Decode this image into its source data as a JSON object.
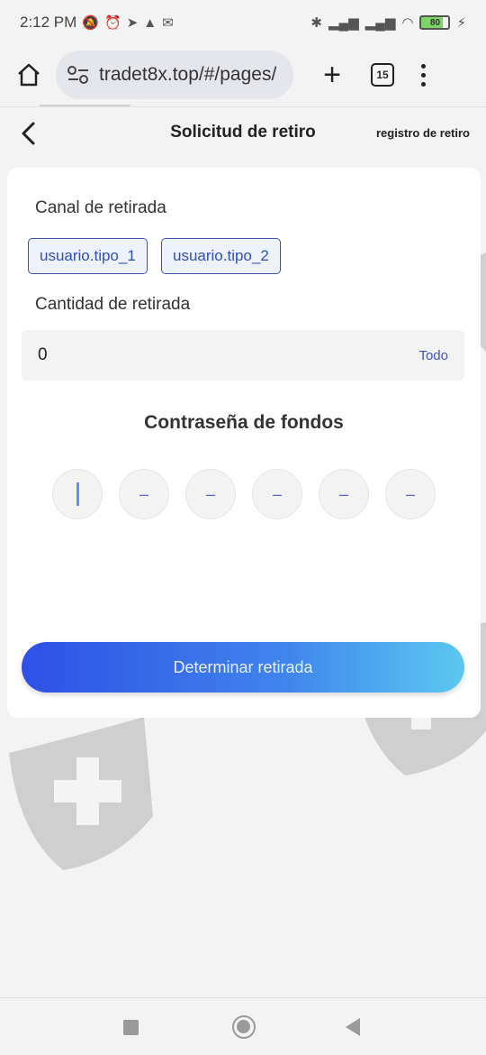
{
  "status_bar": {
    "time": "2:12 PM",
    "battery": "80",
    "icons": [
      "mute-icon",
      "alarm-icon",
      "telegram-icon",
      "app-icon",
      "notification-icon",
      "bluetooth-icon",
      "signal-icon",
      "signal-icon",
      "wifi-icon",
      "battery-icon",
      "charging-icon"
    ]
  },
  "browser": {
    "url": "tradet8x.top/#/pages/",
    "tab_count": "15"
  },
  "header": {
    "title": "Solicitud de retiro",
    "record_link": "registro de retiro"
  },
  "form": {
    "channel_label": "Canal de retirada",
    "channels": [
      {
        "label": "usuario.tipo_1"
      },
      {
        "label": "usuario.tipo_2"
      }
    ],
    "amount_label": "Cantidad de retirada",
    "amount_value": "0",
    "all_label": "Todo",
    "password_title": "Contraseña de fondos",
    "pin_placeholders": [
      "",
      "–",
      "–",
      "–",
      "–",
      "–"
    ],
    "submit_label": "Determinar retirada"
  },
  "colors": {
    "accent": "#3050b8",
    "button_start": "#2f4fe6",
    "button_end": "#5cc8ef",
    "background": "#f3f3f3"
  }
}
